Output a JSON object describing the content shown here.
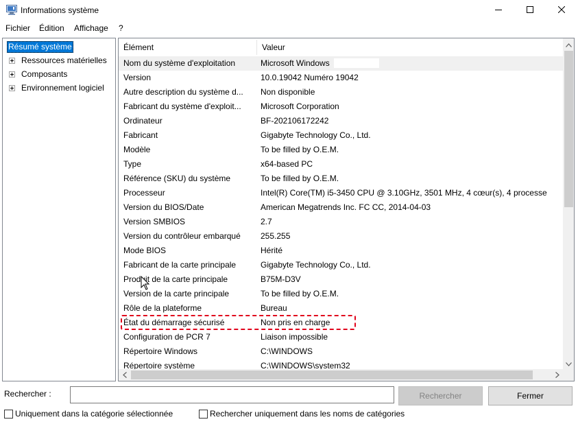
{
  "window": {
    "title": "Informations système",
    "icon": "system-info-icon",
    "controls": [
      "minimize-icon",
      "maximize-icon",
      "close-icon"
    ]
  },
  "menubar": {
    "items": [
      "Fichier",
      "Édition",
      "Affichage",
      "?"
    ]
  },
  "tree": {
    "root": "Résumé système",
    "children": [
      "Ressources matérielles",
      "Composants",
      "Environnement logiciel"
    ]
  },
  "list": {
    "headers": {
      "element": "Élément",
      "value": "Valeur"
    },
    "rows": [
      {
        "element": "Nom du système d'exploitation",
        "value": "Microsoft Windows"
      },
      {
        "element": "Version",
        "value": "10.0.19042 Numéro 19042"
      },
      {
        "element": "Autre description du système d...",
        "value": "Non disponible"
      },
      {
        "element": "Fabricant du système d'exploit...",
        "value": "Microsoft Corporation"
      },
      {
        "element": "Ordinateur",
        "value": "BF-202106172242"
      },
      {
        "element": "Fabricant",
        "value": "Gigabyte Technology Co., Ltd."
      },
      {
        "element": "Modèle",
        "value": "To be filled by O.E.M."
      },
      {
        "element": "Type",
        "value": "x64-based PC"
      },
      {
        "element": "Référence (SKU) du système",
        "value": "To be filled by O.E.M."
      },
      {
        "element": "Processeur",
        "value": "Intel(R) Core(TM) i5-3450 CPU @ 3.10GHz, 3501 MHz, 4 cœur(s), 4 processe"
      },
      {
        "element": "Version du BIOS/Date",
        "value": "American Megatrends Inc. FC CC, 2014-04-03"
      },
      {
        "element": "Version SMBIOS",
        "value": "2.7"
      },
      {
        "element": "Version du contrôleur embarqué",
        "value": "255.255"
      },
      {
        "element": "Mode BIOS",
        "value": "Hérité"
      },
      {
        "element": "Fabricant de la carte principale",
        "value": "Gigabyte Technology Co., Ltd."
      },
      {
        "element": "Produit de la carte principale",
        "value": "B75M-D3V"
      },
      {
        "element": "Version de la carte principale",
        "value": "To be filled by O.E.M."
      },
      {
        "element": "Rôle de la plateforme",
        "value": "Bureau"
      },
      {
        "element": "État du démarrage sécurisé",
        "value": "Non pris en charge"
      },
      {
        "element": "Configuration de PCR 7",
        "value": "Liaison impossible"
      },
      {
        "element": "Répertoire Windows",
        "value": "C:\\WINDOWS"
      },
      {
        "element": "Répertoire système",
        "value": "C:\\WINDOWS\\system32"
      }
    ],
    "selected_row": 0,
    "highlight_color": "#e0001b"
  },
  "search": {
    "label": "Rechercher :",
    "value": "",
    "search_button": "Rechercher",
    "close_button": "Fermer",
    "check_selected_category": "Uniquement dans la catégorie sélectionnée",
    "check_category_names": "Rechercher uniquement dans les noms de catégories"
  }
}
